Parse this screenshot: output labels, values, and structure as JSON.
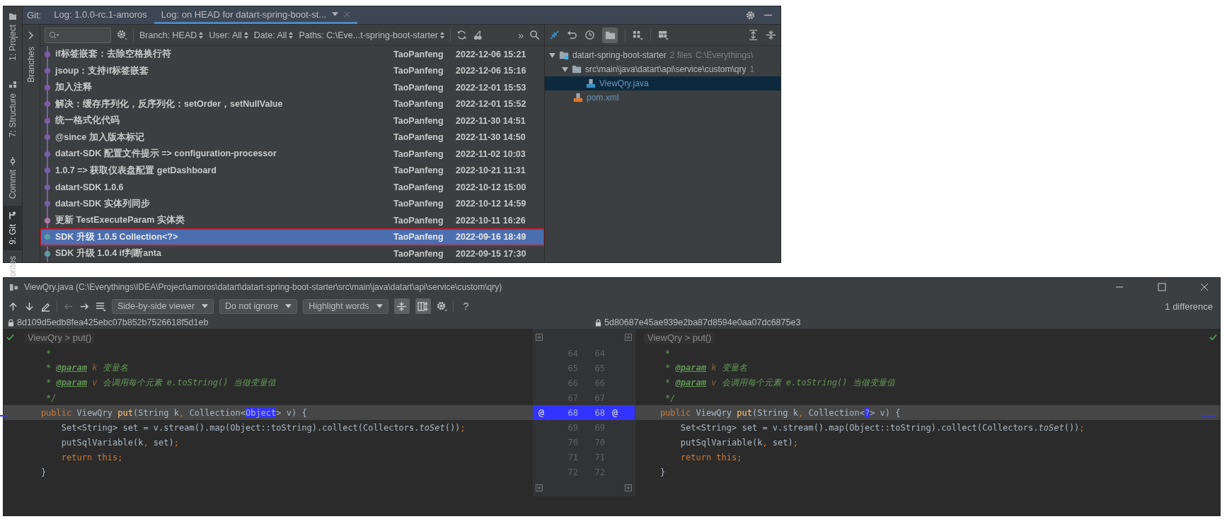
{
  "tool_stripe": [
    {
      "label": "1: Project",
      "kind": "project",
      "selected": false
    },
    {
      "label": "7: Structure",
      "kind": "structure",
      "selected": false
    },
    {
      "label": "Commit",
      "kind": "commit",
      "selected": false
    },
    {
      "label": "9: Git",
      "kind": "git",
      "selected": true
    },
    {
      "label": "orites",
      "kind": "none",
      "selected": false
    }
  ],
  "git_header": {
    "label": "Git:",
    "tabs": [
      {
        "label": "Log: 1.0.0-rc.1-amoros",
        "selected": false
      },
      {
        "label": "Log: on HEAD for datart-spring-boot-st...",
        "selected": true
      }
    ]
  },
  "branches_label": "Branches",
  "log_toolbar": {
    "filters": [
      "Branch: HEAD",
      "User: All",
      "Date: All",
      "Paths: C:\\Eve...t-spring-boot-starter"
    ],
    "more": "»"
  },
  "commits": [
    {
      "message": "if标签嵌套：去除空格换行符",
      "author": "TaoPanfeng",
      "date": "2022-12-06 15:21",
      "color": "#7b5ea8",
      "selected": false
    },
    {
      "message": "jsoup：支持if标签嵌套",
      "author": "TaoPanfeng",
      "date": "2022-12-06 15:16",
      "color": "#7b5ea8",
      "selected": false
    },
    {
      "message": "加入注释",
      "author": "TaoPanfeng",
      "date": "2022-12-01 15:53",
      "color": "#7b5ea8",
      "selected": false
    },
    {
      "message": "解决：缓存序列化，反序列化：setOrder，setNullValue",
      "author": "TaoPanfeng",
      "date": "2022-12-01 15:52",
      "color": "#7b5ea8",
      "selected": false
    },
    {
      "message": "统一格式化代码",
      "author": "TaoPanfeng",
      "date": "2022-11-30 14:51",
      "color": "#7b5ea8",
      "selected": false
    },
    {
      "message": "@since 加入版本标记",
      "author": "TaoPanfeng",
      "date": "2022-11-30 14:50",
      "color": "#7b5ea8",
      "selected": false
    },
    {
      "message": "datart-SDK 配置文件提示 => configuration-processor",
      "author": "TaoPanfeng",
      "date": "2022-11-02 10:03",
      "color": "#7b5ea8",
      "selected": false
    },
    {
      "message": "1.0.7 => 获取仪表盘配置 getDashboard",
      "author": "TaoPanfeng",
      "date": "2022-10-21 11:31",
      "color": "#7b5ea8",
      "selected": false
    },
    {
      "message": "datart-SDK 1.0.6",
      "author": "TaoPanfeng",
      "date": "2022-10-12 15:00",
      "color": "#7b5ea8",
      "selected": false
    },
    {
      "message": "datart-SDK 实体列同步",
      "author": "TaoPanfeng",
      "date": "2022-10-12 14:59",
      "color": "#7b5ea8",
      "selected": false
    },
    {
      "message": "更新 TestExecuteParam 实体类",
      "author": "TaoPanfeng",
      "date": "2022-10-11 16:26",
      "color": "#b07aa8",
      "selected": false
    },
    {
      "message": "SDK 升级 1.0.5 Collection<?>",
      "author": "TaoPanfeng",
      "date": "2022-09-16 18:49",
      "color": "#5f9ea0",
      "selected": true
    },
    {
      "message": "SDK 升级 1.0.4 if判断anta",
      "author": "TaoPanfeng",
      "date": "2022-09-15 17:30",
      "color": "#5f9ea0",
      "selected": false
    }
  ],
  "changes_toolbar": {
    "directory_toggle": {
      "selected": true
    }
  },
  "changes_tree": [
    {
      "label": "datart-spring-boot-starter",
      "kind": "module",
      "detail": "2 files",
      "path": "C:\\Everythings\\",
      "expanded": true,
      "selected": false,
      "children": [
        {
          "label": "src\\main\\java\\datart\\api\\service\\custom\\qry",
          "kind": "folder",
          "detail": "1",
          "expanded": true,
          "selected": false,
          "children": [
            {
              "label": "ViewQry.java",
              "kind": "java",
              "selected": true
            }
          ]
        },
        {
          "label": "pom.xml",
          "kind": "xml",
          "selected": false
        }
      ]
    }
  ],
  "diff": {
    "title": "ViewQry.java (C:\\Everythings\\IDEA\\Project\\amoros\\datart\\datart-spring-boot-starter\\src\\main\\java\\datart\\api\\service\\custom\\qry)",
    "dropdowns": [
      "Side-by-side viewer",
      "Do not ignore",
      "Highlight words"
    ],
    "view_toggles": [
      {
        "kind": "collapse",
        "selected": true
      },
      {
        "kind": "columns",
        "selected": true
      }
    ],
    "help": "?",
    "summary": "1 difference",
    "left_hash": "8d109d5edb8fea425ebc07b852b7526618f5d1eb",
    "right_hash": "5d80687e45ae939e2ba87d8594e0aa07dc6875e3",
    "left_breadcrumb": "ViewQry > put()",
    "right_breadcrumb": "ViewQry > put()",
    "lines": [
      {
        "left_no": "64",
        "right_no": "64",
        "changed": false,
        "left": [
          {
            "kind": "comment",
            "text": "     *"
          }
        ],
        "right": [
          {
            "kind": "comment",
            "text": "     *"
          }
        ]
      },
      {
        "left_no": "65",
        "right_no": "65",
        "changed": false,
        "left": [
          {
            "kind": "comment",
            "text": "     * "
          },
          {
            "kind": "doctag",
            "text": "@param"
          },
          {
            "kind": "docparam",
            "text": " k"
          },
          {
            "kind": "comment",
            "text": " 变量名"
          }
        ],
        "right": [
          {
            "kind": "comment",
            "text": "     * "
          },
          {
            "kind": "doctag",
            "text": "@param"
          },
          {
            "kind": "docparam",
            "text": " k"
          },
          {
            "kind": "comment",
            "text": " 变量名"
          }
        ]
      },
      {
        "left_no": "66",
        "right_no": "66",
        "changed": false,
        "left": [
          {
            "kind": "comment",
            "text": "     * "
          },
          {
            "kind": "doctag",
            "text": "@param"
          },
          {
            "kind": "docparam",
            "text": " v"
          },
          {
            "kind": "comment",
            "text": " 会调用每个元素 e.toString() 当做变量值"
          }
        ],
        "right": [
          {
            "kind": "comment",
            "text": "     * "
          },
          {
            "kind": "doctag",
            "text": "@param"
          },
          {
            "kind": "docparam",
            "text": " v"
          },
          {
            "kind": "comment",
            "text": " 会调用每个元素 e.toString() 当做变量值"
          }
        ]
      },
      {
        "left_no": "67",
        "right_no": "67",
        "changed": false,
        "left": [
          {
            "kind": "comment",
            "text": "     */"
          }
        ],
        "right": [
          {
            "kind": "comment",
            "text": "     */"
          }
        ]
      },
      {
        "left_no": "68",
        "right_no": "68",
        "changed": true,
        "left_marker": "@",
        "right_marker": "@",
        "left": [
          {
            "kind": "keyword",
            "text": "    public"
          },
          {
            "kind": "plain",
            "text": " ViewQry "
          },
          {
            "kind": "method",
            "text": "put"
          },
          {
            "kind": "plain",
            "text": "(String k"
          },
          {
            "kind": "keyword",
            "text": ","
          },
          {
            "kind": "plain",
            "text": " Collection<"
          },
          {
            "kind": "changed",
            "text": "Object"
          },
          {
            "kind": "plain",
            "text": "> v) {"
          }
        ],
        "right": [
          {
            "kind": "keyword",
            "text": "    public"
          },
          {
            "kind": "plain",
            "text": " ViewQry "
          },
          {
            "kind": "method",
            "text": "put"
          },
          {
            "kind": "plain",
            "text": "(String k"
          },
          {
            "kind": "keyword",
            "text": ","
          },
          {
            "kind": "plain",
            "text": " Collection<"
          },
          {
            "kind": "changed",
            "text": "?"
          },
          {
            "kind": "plain",
            "text": "> v) {"
          }
        ]
      },
      {
        "left_no": "69",
        "right_no": "69",
        "changed": false,
        "left": [
          {
            "kind": "plain",
            "text": "        Set<String> set = v.stream().map(Object::toString).collect(Collectors."
          },
          {
            "kind": "static",
            "text": "toSet"
          },
          {
            "kind": "plain",
            "text": "())"
          },
          {
            "kind": "keyword",
            "text": ";"
          }
        ],
        "right": [
          {
            "kind": "plain",
            "text": "        Set<String> set = v.stream().map(Object::toString).collect(Collectors."
          },
          {
            "kind": "static",
            "text": "toSet"
          },
          {
            "kind": "plain",
            "text": "())"
          },
          {
            "kind": "keyword",
            "text": ";"
          }
        ]
      },
      {
        "left_no": "70",
        "right_no": "70",
        "changed": false,
        "left": [
          {
            "kind": "plain",
            "text": "        putSqlVariable(k"
          },
          {
            "kind": "keyword",
            "text": ","
          },
          {
            "kind": "plain",
            "text": " set)"
          },
          {
            "kind": "keyword",
            "text": ";"
          }
        ],
        "right": [
          {
            "kind": "plain",
            "text": "        putSqlVariable(k"
          },
          {
            "kind": "keyword",
            "text": ","
          },
          {
            "kind": "plain",
            "text": " set)"
          },
          {
            "kind": "keyword",
            "text": ";"
          }
        ]
      },
      {
        "left_no": "71",
        "right_no": "71",
        "changed": false,
        "left": [
          {
            "kind": "keyword",
            "text": "        return this;"
          }
        ],
        "right": [
          {
            "kind": "keyword",
            "text": "        return this;"
          }
        ]
      },
      {
        "left_no": "72",
        "right_no": "72",
        "changed": false,
        "left": [
          {
            "kind": "plain",
            "text": "    }"
          }
        ],
        "right": [
          {
            "kind": "plain",
            "text": "    }"
          }
        ]
      }
    ]
  }
}
